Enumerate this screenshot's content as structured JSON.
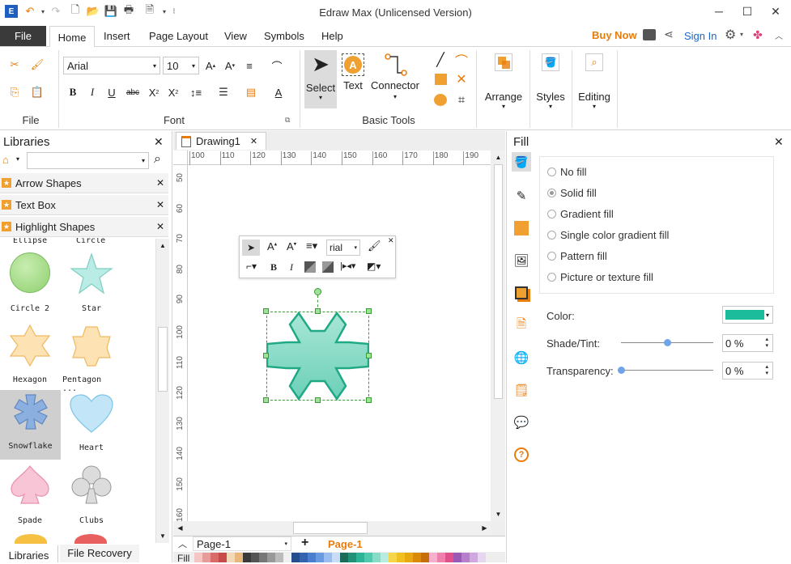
{
  "window": {
    "title": "Edraw Max (Unlicensed Version)"
  },
  "menu": {
    "file": "File",
    "tabs": [
      "Home",
      "Insert",
      "Page Layout",
      "View",
      "Symbols",
      "Help"
    ],
    "buy_now": "Buy Now",
    "sign_in": "Sign In"
  },
  "ribbon": {
    "file_group_label": "File",
    "font": {
      "family": "Arial",
      "size": "10",
      "group_label": "Font"
    },
    "basic_tools": {
      "select": "Select",
      "text": "Text",
      "connector": "Connector",
      "group_label": "Basic Tools"
    },
    "arrange": "Arrange",
    "styles": "Styles",
    "editing": "Editing"
  },
  "libraries": {
    "title": "Libraries",
    "categories": [
      "Arrow Shapes",
      "Text Box",
      "Highlight Shapes"
    ],
    "shapes": [
      {
        "label": "Ellipse"
      },
      {
        "label": "Circle"
      },
      {
        "label": "Circle 2"
      },
      {
        "label": "Star"
      },
      {
        "label": "Hexagon"
      },
      {
        "label": "Pentagon ..."
      },
      {
        "label": "Snowflake"
      },
      {
        "label": "Heart"
      },
      {
        "label": "Spade"
      },
      {
        "label": "Clubs"
      }
    ],
    "bottom_tabs": [
      "Libraries",
      "File Recovery"
    ]
  },
  "document": {
    "tab": "Drawing1",
    "ruler_h": [
      "100",
      "110",
      "120",
      "130",
      "140",
      "150",
      "160",
      "170",
      "180",
      "190"
    ],
    "ruler_v": [
      "50",
      "60",
      "70",
      "80",
      "90",
      "100",
      "110",
      "120",
      "130",
      "140",
      "150",
      "160"
    ],
    "page_selector": "Page-1",
    "page_tab": "Page-1",
    "fill_label": "Fill"
  },
  "float_toolbar": {
    "font": "rial"
  },
  "fill_panel": {
    "title": "Fill",
    "options": [
      "No fill",
      "Solid fill",
      "Gradient fill",
      "Single color gradient fill",
      "Pattern fill",
      "Picture or texture fill"
    ],
    "selected_index": 1,
    "color_label": "Color:",
    "color_value": "#1abc9c",
    "shade_label": "Shade/Tint:",
    "shade_value": "0 %",
    "shade_level": 0.5,
    "transparency_label": "Transparency:",
    "transparency_value": "0 %",
    "transparency_level": 0
  },
  "colors": {
    "accent": "#e87d0d",
    "link": "#1a66c8",
    "teal": "#1abc9c"
  }
}
